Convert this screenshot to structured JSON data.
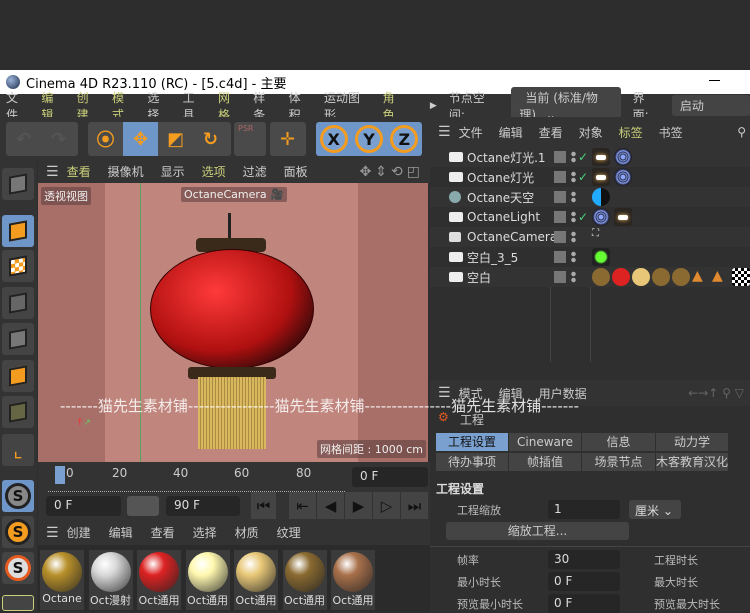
{
  "window": {
    "title": "Cinema 4D R23.110 (RC) - [5.c4d] - 主要"
  },
  "menubar": {
    "items": [
      "文件",
      "编辑",
      "创建",
      "模式",
      "选择",
      "工具",
      "网格",
      "样条",
      "体积",
      "运动图形",
      "角色"
    ],
    "highlighted": [
      "编辑",
      "创建",
      "模式",
      "网格",
      "角色"
    ],
    "node_space_label": "节点空间:",
    "node_space_value": "当前 (标准/物理)",
    "layout_label": "界面:",
    "layout_value": "启动"
  },
  "toolbar": {
    "psr_label": "PSR",
    "axes": [
      "X",
      "Y",
      "Z"
    ]
  },
  "viewport": {
    "menu": [
      "查看",
      "摄像机",
      "显示",
      "选项",
      "过滤",
      "面板"
    ],
    "view_name": "透视视图",
    "camera_tag": "OctaneCamera",
    "grid_info": "网格间距 : 1000 cm"
  },
  "timeline": {
    "ticks": [
      "0",
      "20",
      "40",
      "60",
      "80"
    ],
    "current_frame": "0 F",
    "start": "0 F",
    "end": "90 F"
  },
  "materials": {
    "menu": [
      "创建",
      "编辑",
      "查看",
      "选择",
      "材质",
      "纹理"
    ],
    "items": [
      {
        "label": "Octane",
        "color": "#b8902a"
      },
      {
        "label": "Oct漫射",
        "color": "#d8d8d8"
      },
      {
        "label": "Oct通用",
        "color": "#dd2222"
      },
      {
        "label": "Oct通用",
        "color": "#fff8b0"
      },
      {
        "label": "Oct通用",
        "color": "#e8c878"
      },
      {
        "label": "Oct通用",
        "color": "#8a6a30"
      },
      {
        "label": "Oct通用",
        "color": "#a8704a"
      }
    ]
  },
  "object_manager": {
    "menu": [
      "文件",
      "编辑",
      "查看",
      "对象",
      "标签",
      "书签"
    ],
    "highlighted": "标签",
    "objects": [
      {
        "name": "Octane灯光.1",
        "check": true
      },
      {
        "name": "Octane灯光",
        "check": true
      },
      {
        "name": "Octane天空",
        "check": false
      },
      {
        "name": "OctaneLight",
        "check": true
      },
      {
        "name": "OctaneCamera",
        "check": false
      },
      {
        "name": "空白_3_5",
        "check": false
      },
      {
        "name": "空白",
        "check": false
      }
    ]
  },
  "attributes": {
    "menu": [
      "模式",
      "编辑",
      "用户数据"
    ],
    "object": "工程",
    "tabs_row1": [
      "工程设置",
      "Cineware",
      "信息",
      "动力学"
    ],
    "tabs_row2": [
      "待办事项",
      "帧插值",
      "场景节点",
      "木客教育汉化"
    ],
    "active_tab": "工程设置",
    "section": "工程设置",
    "scale_label": "工程缩放",
    "scale_value": "1",
    "scale_unit": "厘米",
    "scale_button": "缩放工程...",
    "fps_label": "帧率",
    "fps_value": "30",
    "project_len_label": "工程时长",
    "min_label": "最小时长",
    "min_value": "0 F",
    "max_label": "最大时长",
    "pmin_label": "预览最小时长",
    "pmin_value": "0 F",
    "pmax_label": "预览最大时长"
  },
  "watermark": "-------猫先生素材铺----------------猫先生素材铺----------------猫先生素材铺-------",
  "accent": "#f39c1f",
  "selection": "#6f96c9"
}
